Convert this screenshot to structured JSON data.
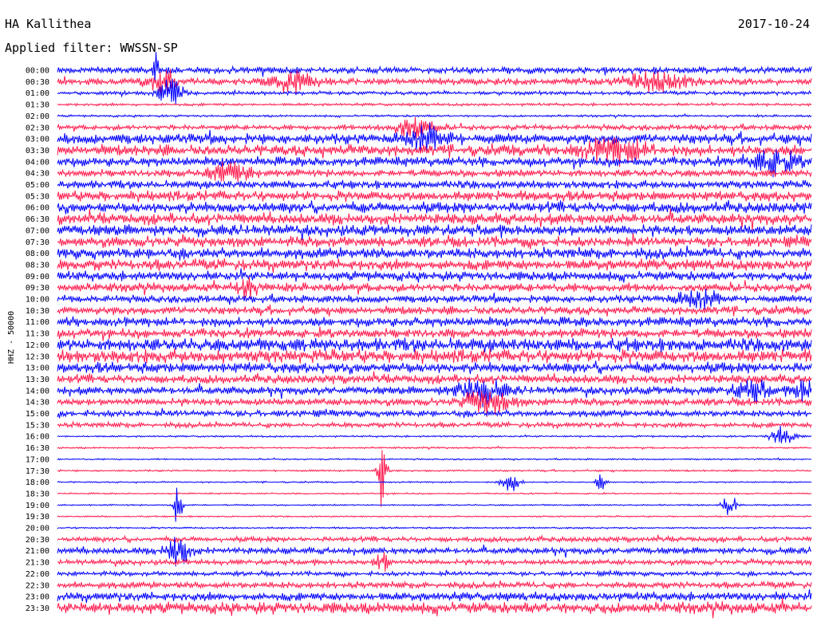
{
  "header": {
    "station": "HA Kallithea",
    "date": "2017-10-24",
    "filter_label": "Applied filter:",
    "filter_name": "WWSSN-SP"
  },
  "colors": {
    "trace_a": "#0000ff",
    "trace_b": "#ff1a4d",
    "background": "#ffffff",
    "text": "#000000"
  },
  "chart_data": {
    "type": "line",
    "title": "HA Kallithea",
    "date": "2017-10-24",
    "ylabel": "HHZ - 50000",
    "xlabel": "",
    "grid": false,
    "legend": "none",
    "color_cycle": [
      "#0000ff",
      "#ff1a4d"
    ],
    "y_tick_labels": [
      "00:00",
      "00:30",
      "01:00",
      "01:30",
      "02:00",
      "02:30",
      "03:00",
      "03:30",
      "04:00",
      "04:30",
      "05:00",
      "05:30",
      "06:00",
      "06:30",
      "07:00",
      "07:30",
      "08:00",
      "08:30",
      "09:00",
      "09:30",
      "10:00",
      "10:30",
      "11:00",
      "11:30",
      "12:00",
      "12:30",
      "13:00",
      "13:30",
      "14:00",
      "14:30",
      "15:00",
      "15:30",
      "16:00",
      "16:30",
      "17:00",
      "17:30",
      "18:00",
      "18:30",
      "19:00",
      "19:30",
      "20:00",
      "20:30",
      "21:00",
      "21:30",
      "22:00",
      "22:30",
      "23:00",
      "23:30"
    ],
    "trace_noise_level": [
      0.45,
      0.45,
      0.25,
      0.18,
      0.15,
      0.35,
      0.7,
      0.75,
      0.65,
      0.5,
      0.55,
      0.7,
      0.75,
      0.75,
      0.75,
      0.7,
      0.75,
      0.75,
      0.65,
      0.6,
      0.5,
      0.55,
      0.65,
      0.65,
      0.9,
      0.9,
      0.75,
      0.6,
      0.55,
      0.5,
      0.45,
      0.35,
      0.12,
      0.12,
      0.1,
      0.12,
      0.1,
      0.1,
      0.1,
      0.1,
      0.12,
      0.35,
      0.45,
      0.35,
      0.3,
      0.45,
      0.6,
      0.8
    ],
    "events": [
      {
        "line": 0,
        "x": 0.13,
        "amp": 5,
        "width": 0.002
      },
      {
        "line": 1,
        "x": 0.14,
        "amp": 2.5,
        "width": 0.01
      },
      {
        "line": 1,
        "x": 0.31,
        "amp": 1.6,
        "width": 0.02
      },
      {
        "line": 1,
        "x": 0.79,
        "amp": 1.4,
        "width": 0.03
      },
      {
        "line": 2,
        "x": 0.15,
        "amp": 2.5,
        "width": 0.01
      },
      {
        "line": 5,
        "x": 0.47,
        "amp": 1.6,
        "width": 0.02
      },
      {
        "line": 6,
        "x": 0.49,
        "amp": 1.8,
        "width": 0.02
      },
      {
        "line": 7,
        "x": 0.74,
        "amp": 1.7,
        "width": 0.03
      },
      {
        "line": 8,
        "x": 0.95,
        "amp": 1.8,
        "width": 0.02
      },
      {
        "line": 9,
        "x": 0.23,
        "amp": 1.5,
        "width": 0.02
      },
      {
        "line": 19,
        "x": 0.25,
        "amp": 1.5,
        "width": 0.01
      },
      {
        "line": 20,
        "x": 0.85,
        "amp": 1.4,
        "width": 0.02
      },
      {
        "line": 28,
        "x": 0.56,
        "amp": 2.2,
        "width": 0.02
      },
      {
        "line": 28,
        "x": 0.92,
        "amp": 1.6,
        "width": 0.015
      },
      {
        "line": 28,
        "x": 0.99,
        "amp": 1.6,
        "width": 0.01
      },
      {
        "line": 29,
        "x": 0.57,
        "amp": 1.8,
        "width": 0.02
      },
      {
        "line": 32,
        "x": 0.96,
        "amp": 1.8,
        "width": 0.01
      },
      {
        "line": 35,
        "x": 0.43,
        "amp": 6,
        "width": 0.004
      },
      {
        "line": 36,
        "x": 0.6,
        "amp": 1.6,
        "width": 0.008
      },
      {
        "line": 36,
        "x": 0.72,
        "amp": 1.6,
        "width": 0.004
      },
      {
        "line": 38,
        "x": 0.89,
        "amp": 2.2,
        "width": 0.006
      },
      {
        "line": 38,
        "x": 0.16,
        "amp": 4,
        "width": 0.004
      },
      {
        "line": 42,
        "x": 0.16,
        "amp": 2.5,
        "width": 0.01
      },
      {
        "line": 43,
        "x": 0.43,
        "amp": 1.8,
        "width": 0.006
      }
    ]
  }
}
